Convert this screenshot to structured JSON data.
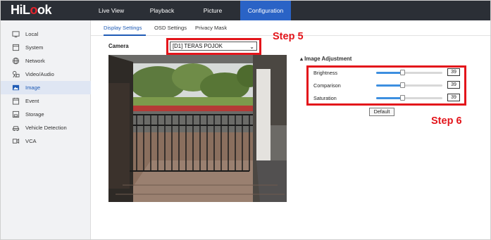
{
  "brand": {
    "logo_text_a": "HiL",
    "logo_text_b": "o",
    "logo_text_c": "ok"
  },
  "nav": [
    {
      "label": "Live View"
    },
    {
      "label": "Playback"
    },
    {
      "label": "Picture"
    },
    {
      "label": "Configuration",
      "active": true
    }
  ],
  "sidebar": {
    "items": [
      {
        "label": "Local",
        "icon": "monitor-icon"
      },
      {
        "label": "System",
        "icon": "system-icon"
      },
      {
        "label": "Network",
        "icon": "globe-icon"
      },
      {
        "label": "Video/Audio",
        "icon": "video-audio-icon"
      },
      {
        "label": "Image",
        "icon": "image-icon",
        "active": true
      },
      {
        "label": "Event",
        "icon": "event-icon"
      },
      {
        "label": "Storage",
        "icon": "storage-icon"
      },
      {
        "label": "Vehicle Detection",
        "icon": "vehicle-icon"
      },
      {
        "label": "VCA",
        "icon": "vca-icon"
      }
    ]
  },
  "subtabs": [
    {
      "label": "Display Settings",
      "active": true
    },
    {
      "label": "OSD Settings"
    },
    {
      "label": "Privacy Mask"
    }
  ],
  "camera": {
    "label": "Camera",
    "selected": "[D1] TERAS POJOK"
  },
  "annotations": {
    "step5": "Step 5",
    "step6": "Step 6"
  },
  "image_adjustment": {
    "title": "Image Adjustment",
    "rows": [
      {
        "label": "Brightness",
        "value": "39",
        "level": 0.39
      },
      {
        "label": "Comparison",
        "value": "39",
        "level": 0.39
      },
      {
        "label": "Saturation",
        "value": "39",
        "level": 0.39
      }
    ],
    "default_label": "Default"
  },
  "colors": {
    "topbar": "#2b2f36",
    "active_tab": "#2a63c6",
    "annotation_red": "#e3151b",
    "slider_fill": "#3d8fe0"
  }
}
